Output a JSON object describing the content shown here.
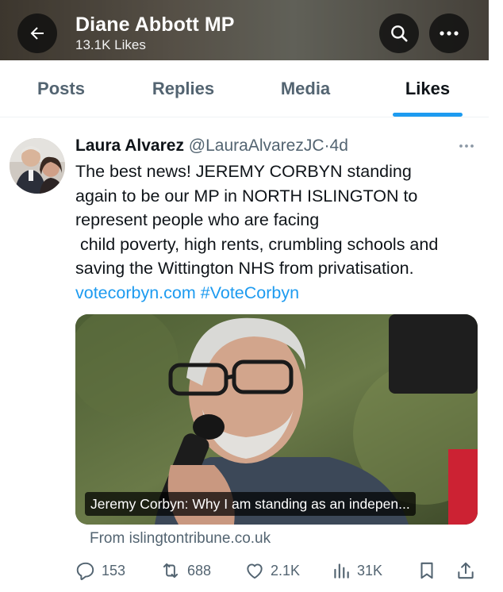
{
  "header": {
    "title": "Diane Abbott MP",
    "subtitle": "13.1K Likes",
    "icons": {
      "back": "back-arrow-icon",
      "search": "search-icon",
      "more": "more-icon"
    }
  },
  "tabs": [
    {
      "label": "Posts",
      "active": false
    },
    {
      "label": "Replies",
      "active": false
    },
    {
      "label": "Media",
      "active": false
    },
    {
      "label": "Likes",
      "active": true
    }
  ],
  "tweet": {
    "author": "Laura Alvarez",
    "handle": "@LauraAlvarezJC",
    "separator": "·",
    "time": "4d",
    "text_lines": [
      "The best news! JEREMY CORBYN standing",
      "again to be our MP in NORTH ISLINGTON to",
      "represent people who are facing",
      " child poverty, high rents, crumbling schools and",
      "saving the Wittington NHS from privatisation."
    ],
    "link_url": "votecorbyn.com",
    "hashtag": "#VoteCorbyn",
    "media_caption": "Jeremy Corbyn: Why I am standing as an indepen...",
    "source": "From islingtontribune.co.uk",
    "stats": {
      "replies": "153",
      "reposts": "688",
      "likes": "2.1K",
      "views": "31K"
    }
  },
  "colors": {
    "accent": "#1d9bf0",
    "text_primary": "#0f1419",
    "text_secondary": "#536471"
  }
}
